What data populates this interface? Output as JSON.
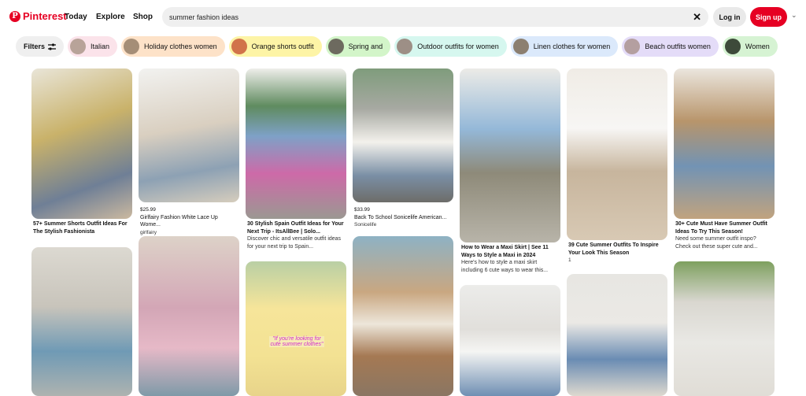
{
  "brand": {
    "name": "Pinterest"
  },
  "nav": {
    "today": "Today",
    "explore": "Explore",
    "shop": "Shop"
  },
  "search": {
    "query": "summer fashion ideas"
  },
  "auth": {
    "login": "Log in",
    "signup": "Sign up"
  },
  "filters": {
    "label": "Filters"
  },
  "chips": [
    {
      "label": "Italian",
      "color": "#fbe3ea"
    },
    {
      "label": "Holiday clothes women",
      "color": "#fde2c8"
    },
    {
      "label": "Orange shorts outfit",
      "color": "#fdf4a6"
    },
    {
      "label": "Spring and",
      "color": "#d3f5c9"
    },
    {
      "label": "Outdoor outfits for women",
      "color": "#d6f7ef"
    },
    {
      "label": "Linen clothes for women",
      "color": "#dbe9fb"
    },
    {
      "label": "Beach outfits women",
      "color": "#e4dcf8"
    },
    {
      "label": "Women",
      "color": "#d6f3d3"
    }
  ],
  "pins": [
    {
      "title": "57+ Summer Shorts Outfit Ideas For The Stylish Fashionista",
      "bg": "#c7c2a8"
    },
    {
      "price": "$25.99",
      "title": "Girlfairy Fashion White Lace Up Wome...",
      "source": "girlfairy",
      "bg": "#d8d2c8"
    },
    {
      "title": "30 Stylish Spain Outfit Ideas for Your Next Trip - ItsAllBee | Solo...",
      "desc": "Discover chic and versatile outfit ideas for your next trip to Spain...",
      "bg": "#7e9a7f"
    },
    {
      "price": "$33.99",
      "title": "Back To School Sonicelife American...",
      "source": "Sonicelife",
      "bg": "#8a8f8c"
    },
    {
      "title": "How to Wear a Maxi Skirt | See 11 Ways to Style a Maxi in 2024",
      "desc": "Here's how to style a maxi skirt including 6 cute ways to wear this...",
      "bg": "#d8d3cc"
    },
    {
      "title": "39 Cute Summer Outfits To Inspire Your Look This Season",
      "source": "1",
      "bg": "#e7e2dc"
    },
    {
      "title": "30+ Cute Must Have Summer Outfit Ideas To Try This Season!",
      "desc": "Need some summer outfit inspo? Check out these super cute and...",
      "bg": "#b9a07c"
    },
    {
      "bg": "#a7a7a2"
    },
    {
      "bg": "#c9a7b0"
    },
    {
      "overlay": "\"If you're looking for cute summer clothes\"",
      "bg": "#f1e4a4"
    },
    {
      "bg": "#b99a7c"
    },
    {
      "bg": "#e2e2e2"
    },
    {
      "bg": "#ececea"
    },
    {
      "bg": "#e8e5dd"
    }
  ]
}
